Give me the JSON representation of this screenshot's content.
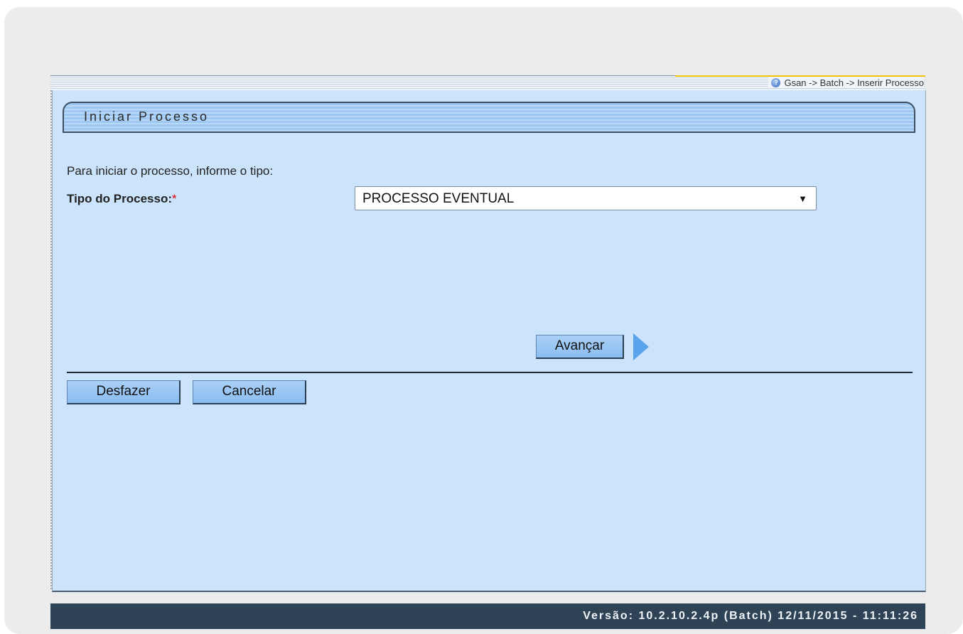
{
  "breadcrumb": "Gsan -> Batch -> Inserir Processo",
  "section": {
    "title": "Iniciar Processo"
  },
  "form": {
    "instruction": "Para iniciar o processo, informe o tipo:",
    "tipo_label": "Tipo do Processo:",
    "required_mark": "*",
    "tipo_value": "PROCESSO EVENTUAL",
    "dropdown_arrow": "▼"
  },
  "buttons": {
    "avancar": "Avançar",
    "desfazer": "Desfazer",
    "cancelar": "Cancelar"
  },
  "footer": {
    "version": "Versão: 10.2.10.2.4p (Batch) 12/11/2015 - 11:11:26"
  },
  "icons": {
    "help": "help-icon",
    "next": "next-arrow-icon"
  },
  "colors": {
    "panel_bg": "#cbe3fb",
    "footer_bg": "#2f4356",
    "button_bg": "#8bbdf0"
  }
}
